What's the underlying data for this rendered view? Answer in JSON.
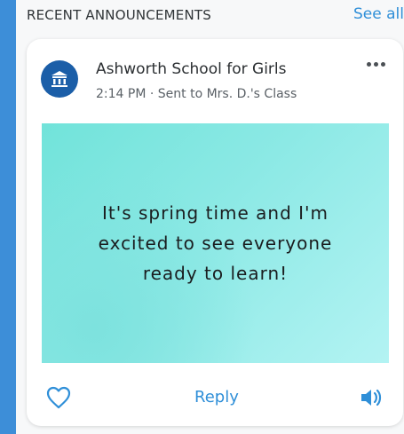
{
  "section": {
    "title": "RECENT ANNOUNCEMENTS",
    "see_all": "See all"
  },
  "announcement": {
    "sender": "Ashworth School for Girls",
    "meta": "2:14 PM · Sent to Mrs. D.'s Class",
    "message": "It's spring time and I'm excited to see everyone ready to learn!",
    "reply_label": "Reply"
  },
  "icons": {
    "avatar": "school-building-icon",
    "more": "more-options-icon",
    "like": "heart-icon",
    "audio": "speaker-icon"
  },
  "colors": {
    "rail": "#3d8ed8",
    "accent": "#2f8fd8",
    "avatar_bg": "#1b5ea8",
    "image_bg": "#8ce9e5"
  }
}
